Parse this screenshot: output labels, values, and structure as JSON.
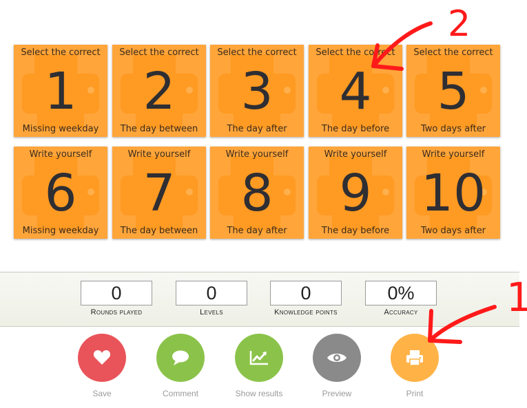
{
  "tiles": [
    {
      "top": "Select the correct",
      "num": "1",
      "bottom": "Missing weekday"
    },
    {
      "top": "Select the correct",
      "num": "2",
      "bottom": "The day between"
    },
    {
      "top": "Select the correct",
      "num": "3",
      "bottom": "The day after"
    },
    {
      "top": "Select the correct",
      "num": "4",
      "bottom": "The day before"
    },
    {
      "top": "Select the correct",
      "num": "5",
      "bottom": "Two days after"
    },
    {
      "top": "Write yourself",
      "num": "6",
      "bottom": "Missing weekday"
    },
    {
      "top": "Write yourself",
      "num": "7",
      "bottom": "The day between"
    },
    {
      "top": "Write yourself",
      "num": "8",
      "bottom": "The day after"
    },
    {
      "top": "Write yourself",
      "num": "9",
      "bottom": "The day before"
    },
    {
      "top": "Write yourself",
      "num": "10",
      "bottom": "Two days after"
    }
  ],
  "stats": [
    {
      "value": "0",
      "label": "Rounds played"
    },
    {
      "value": "0",
      "label": "Levels"
    },
    {
      "value": "0",
      "label": "Knowledge points"
    },
    {
      "value": "0%",
      "label": "Accuracy"
    }
  ],
  "actions": [
    {
      "label": "Save",
      "icon": "heart-icon",
      "color": "#e9545a"
    },
    {
      "label": "Comment",
      "icon": "speech-bubble-icon",
      "color": "#8bc34a"
    },
    {
      "label": "Show results",
      "icon": "line-chart-icon",
      "color": "#8bc34a"
    },
    {
      "label": "Preview",
      "icon": "eye-icon",
      "color": "#8a8a8a"
    },
    {
      "label": "Print",
      "icon": "printer-icon",
      "color": "#ffb347"
    }
  ],
  "annotations": {
    "marker_1": "1",
    "marker_2": "2",
    "color": "#ff1a1a"
  }
}
